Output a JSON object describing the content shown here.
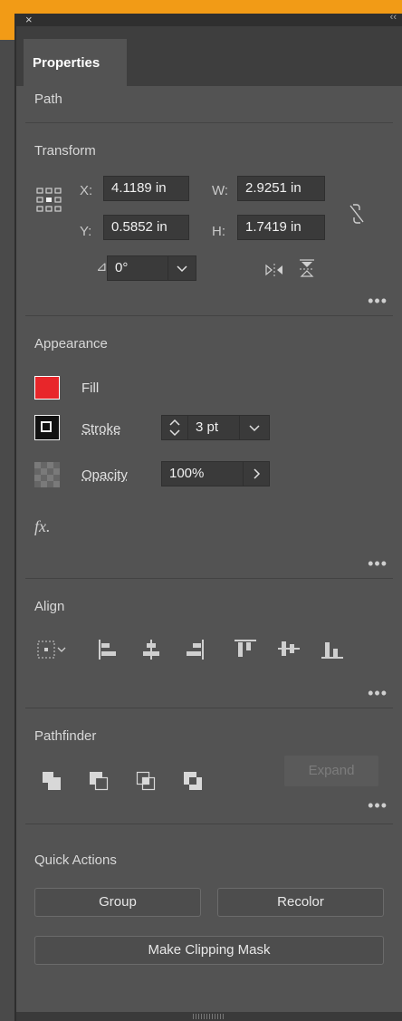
{
  "window": {
    "close_glyph": "×",
    "collapse_glyph": "‹‹"
  },
  "tabs": [
    {
      "label": "Properties",
      "active": true
    }
  ],
  "object_type": "Path",
  "transform": {
    "title": "Transform",
    "x_label": "X:",
    "x_value": "4.1189 in",
    "y_label": "Y:",
    "y_value": "0.5852 in",
    "w_label": "W:",
    "w_value": "2.9251 in",
    "h_label": "H:",
    "h_value": "1.7419 in",
    "angle_label": "⊿:",
    "angle_value": "0°"
  },
  "appearance": {
    "title": "Appearance",
    "fill_label": "Fill",
    "fill_color": "#e8262a",
    "stroke_label": "Stroke",
    "stroke_value": "3 pt",
    "opacity_label": "Opacity",
    "opacity_value": "100%",
    "fx_label": "fx."
  },
  "align": {
    "title": "Align"
  },
  "pathfinder": {
    "title": "Pathfinder",
    "expand_label": "Expand"
  },
  "quick_actions": {
    "title": "Quick Actions",
    "group_label": "Group",
    "recolor_label": "Recolor",
    "clipping_mask_label": "Make Clipping Mask"
  },
  "more_glyph": "•••"
}
